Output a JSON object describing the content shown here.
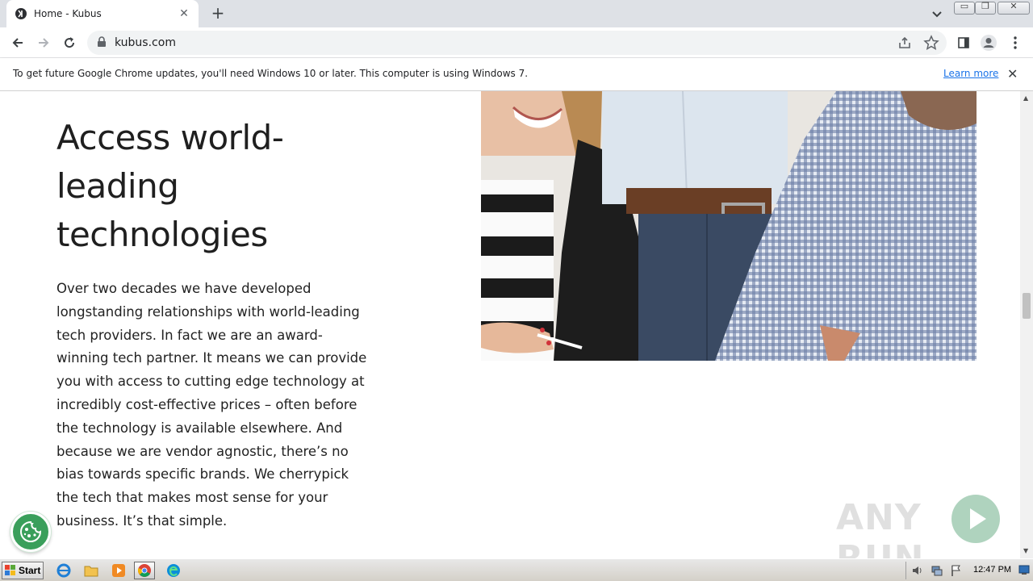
{
  "browser": {
    "tab": {
      "title": "Home - Kubus",
      "close_glyph": "✕"
    },
    "new_tab_glyph": "+",
    "address": {
      "url": "kubus.com"
    },
    "window_controls": {
      "minimize": "▭",
      "maximize": "❐",
      "close": "✕"
    }
  },
  "infobar": {
    "message": "To get future Google Chrome updates, you'll need Windows 10 or later. This computer is using Windows 7.",
    "link": "Learn more",
    "close_glyph": "✕"
  },
  "page": {
    "heading": "Access world-leading technologies",
    "body": "Over two decades we have developed longstanding relationships with world-leading tech providers. In fact we are an award-winning tech partner. It means we can provide you with access to cutting edge technology at incredibly cost-effective prices – often before the technology is available elsewhere. And because we are vendor agnostic, there’s no bias towards specific brands. We cherrypick the tech that makes most sense for your business. It’s that simple."
  },
  "watermark": {
    "text": "ANY RUN"
  },
  "taskbar": {
    "start_label": "Start",
    "clock": "12:47 PM"
  },
  "colors": {
    "accent_green": "#3a9f5b",
    "link_blue": "#1a73e8",
    "tabstrip": "#dee1e6"
  }
}
